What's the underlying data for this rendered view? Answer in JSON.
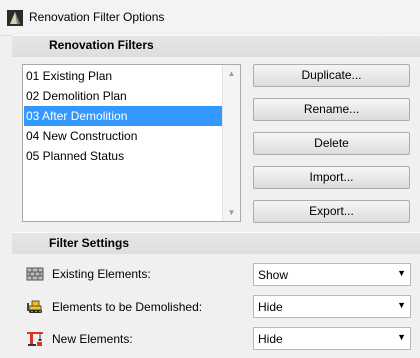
{
  "window": {
    "title": "Renovation Filter Options"
  },
  "filters": {
    "heading": "Renovation Filters",
    "items": [
      {
        "label": "01 Existing Plan"
      },
      {
        "label": "02 Demolition Plan"
      },
      {
        "label": "03 After Demolition"
      },
      {
        "label": "04 New Construction"
      },
      {
        "label": "05 Planned Status"
      }
    ],
    "selected_index": 2
  },
  "buttons": {
    "duplicate": "Duplicate...",
    "rename": "Rename...",
    "delete": "Delete",
    "import": "Import...",
    "export": "Export..."
  },
  "settings": {
    "heading": "Filter Settings",
    "rows": [
      {
        "label": "Existing Elements:",
        "value": "Show",
        "icon": "brick-wall-icon"
      },
      {
        "label": "Elements to be Demolished:",
        "value": "Hide",
        "icon": "bulldozer-icon"
      },
      {
        "label": "New Elements:",
        "value": "Hide",
        "icon": "crane-icon"
      }
    ]
  },
  "colors": {
    "selection": "#3399ff",
    "icon_red": "#e03020",
    "icon_yellow": "#f0c020"
  }
}
